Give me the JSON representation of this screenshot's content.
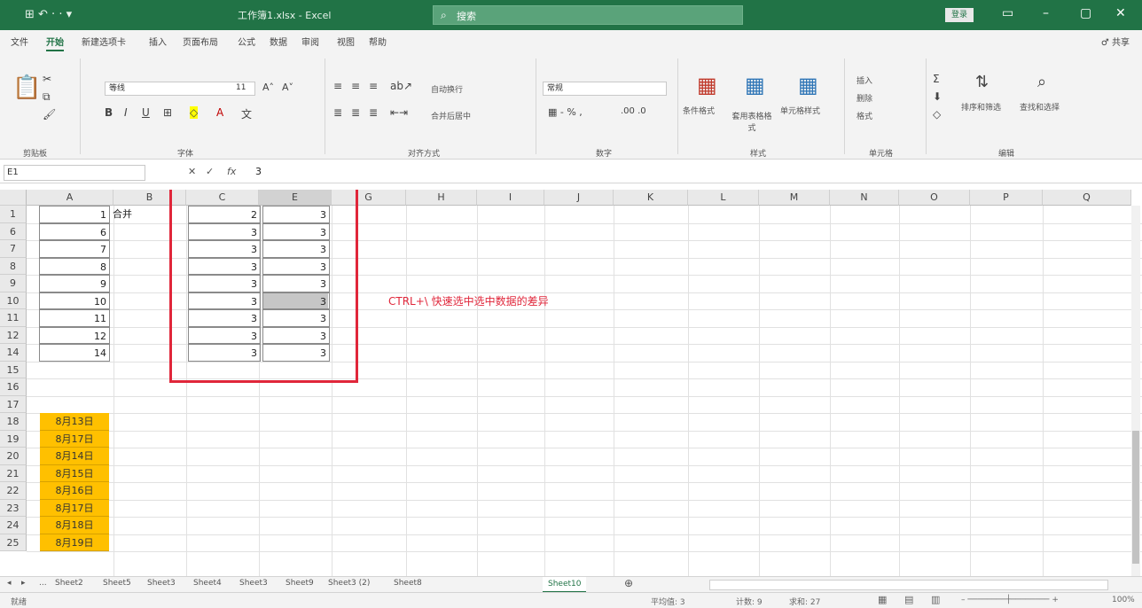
{
  "titlebar": {
    "quick_access": "⊞ ↶ ·  ·  ▾",
    "title": "工作簿1.xlsx - Excel",
    "search_placeholder": "搜索",
    "login": "登录",
    "ribbon_display": "▭",
    "minimize": "–",
    "maximize": "▢",
    "close": "✕"
  },
  "menu": {
    "tabs": [
      "文件",
      "开始",
      "新建选项卡",
      "插入",
      "页面布局",
      "公式",
      "数据",
      "审阅",
      "视图",
      "帮助"
    ],
    "share": "♂ 共享"
  },
  "ribbon": {
    "clipboard_label": "剪贴板",
    "font_name": "等线",
    "font_size": "11",
    "font_label": "字体",
    "align_label": "对齐方式",
    "wrap": "自动换行",
    "merge": "合并后居中",
    "number_format": "常规",
    "number_label": "数字",
    "cond_format": "条件格式",
    "table_format": "套用表格格式",
    "cell_style": "单元格样式",
    "style_label": "样式",
    "insert": "插入",
    "delete": "删除",
    "format": "格式",
    "cells_label": "单元格",
    "sort_filter": "排序和筛选",
    "find_select": "查找和选择",
    "edit_label": "编辑"
  },
  "formula_bar": {
    "name_box": "E1",
    "cancel": "✕",
    "enter": "✓",
    "fx": "fx",
    "formula": "3"
  },
  "grid": {
    "columns": [
      "A",
      "B",
      "C",
      "E",
      "G",
      "H",
      "I",
      "J",
      "K",
      "L",
      "M",
      "N",
      "O",
      "P",
      "Q"
    ],
    "rows": [
      "1",
      "6",
      "7",
      "8",
      "9",
      "10",
      "11",
      "12",
      "14",
      "15",
      "16",
      "17",
      "18",
      "19",
      "20",
      "21",
      "22",
      "23",
      "24",
      "25"
    ],
    "col_a": [
      "1",
      "6",
      "7",
      "8",
      "9",
      "10",
      "11",
      "12",
      "14"
    ],
    "b1": "合并",
    "col_c": [
      "2",
      "3",
      "3",
      "3",
      "3",
      "3",
      "3",
      "3",
      "3"
    ],
    "col_e": [
      "3",
      "3",
      "3",
      "3",
      "3",
      "3",
      "3",
      "3",
      "3"
    ],
    "dates": [
      "8月13日",
      "8月17日",
      "8月14日",
      "8月15日",
      "8月16日",
      "8月17日",
      "8月18日",
      "8月19日"
    ],
    "annotation": "CTRL+\\ 快速选中选中数据的差异"
  },
  "sheets": {
    "tabs": [
      "Sheet2",
      "Sheet5",
      "Sheet3",
      "Sheet4",
      "Sheet3",
      "Sheet9",
      "Sheet3 (2)",
      "Sheet8",
      "Sheet10"
    ],
    "active": "Sheet10",
    "add": "⊕"
  },
  "status": {
    "mode": "就绪",
    "average": "平均值: 3",
    "count": "计数: 9",
    "sum": "求和: 27",
    "zoom": "100%"
  }
}
